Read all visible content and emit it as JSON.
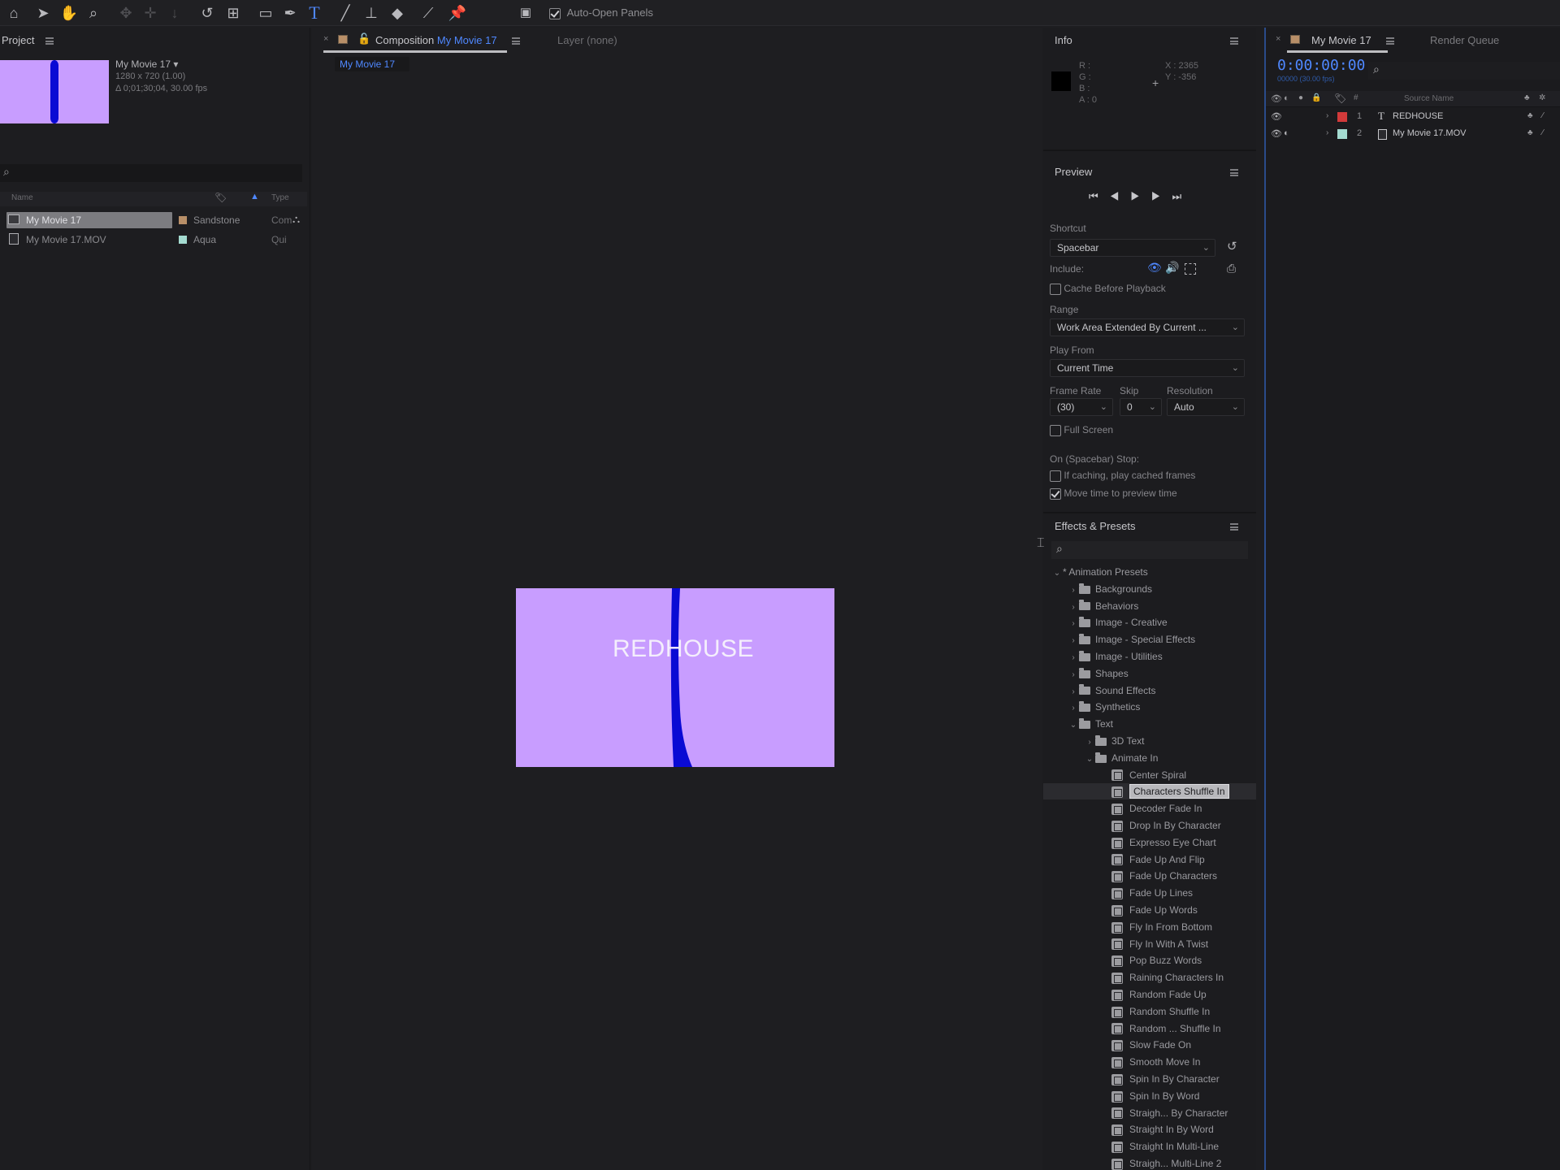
{
  "toolbar": {
    "tools": [
      "home-icon",
      "selection-tool-icon",
      "hand-tool-icon",
      "zoom-tool-icon",
      "orbit-camera-icon",
      "pan-camera-icon",
      "dolly-camera-icon",
      "rotate-tool-icon",
      "pan-behind-tool-icon",
      "rectangle-tool-icon",
      "pen-tool-icon",
      "type-tool-icon",
      "brush-tool-icon",
      "clone-stamp-tool-icon",
      "eraser-tool-icon",
      "roto-brush-tool-icon",
      "puppet-pin-tool-icon"
    ],
    "auto_open_label": "Auto-Open Panels",
    "auto_open_checked": true
  },
  "project": {
    "title": "Project",
    "comp_name": "My Movie 17",
    "comp_info_line1": "1280 x 720 (1.00)",
    "comp_info_line2": "Δ 0;01;30;04, 30.00 fps",
    "search_placeholder": "",
    "columns": {
      "name": "Name",
      "type": "Type"
    },
    "items": [
      {
        "name": "My Movie 17",
        "label": "Sandstone",
        "label_color": "#b88f68",
        "type": "Com",
        "selected": true
      },
      {
        "name": "My Movie 17.MOV",
        "label": "Aqua",
        "label_color": "#a4dbd0",
        "type": "Qui",
        "selected": false
      }
    ]
  },
  "composition": {
    "tab_prefix": "Composition",
    "tab_name": "My Movie 17",
    "layer_tab": "Layer (none)",
    "breadcrumb": "My Movie 17",
    "preview_text": "REDHOUSE",
    "frame_color": "#c89dff",
    "accent_color": "#0a0ad4"
  },
  "info": {
    "title": "Info",
    "r": "R :",
    "g": "G :",
    "b": "B :",
    "a": "A : 0",
    "x": "X : 2365",
    "y": "Y : -356"
  },
  "preview": {
    "title": "Preview",
    "shortcut_label": "Shortcut",
    "shortcut_value": "Spacebar",
    "include_label": "Include:",
    "cache_label": "Cache Before Playback",
    "range_label": "Range",
    "range_value": "Work Area Extended By Current ...",
    "play_from_label": "Play From",
    "play_from_value": "Current Time",
    "frame_rate_label": "Frame Rate",
    "skip_label": "Skip",
    "resolution_label": "Resolution",
    "frame_rate_value": "(30)",
    "skip_value": "0",
    "resolution_value": "Auto",
    "full_screen_label": "Full Screen",
    "stop_label": "On (Spacebar) Stop:",
    "if_caching_label": "If caching, play cached frames",
    "move_time_label": "Move time to preview time",
    "move_time_checked": true
  },
  "effects": {
    "title": "Effects & Presets",
    "root": "* Animation Presets",
    "folders": [
      "Backgrounds",
      "Behaviors",
      "Image - Creative",
      "Image - Special Effects",
      "Image - Utilities",
      "Shapes",
      "Sound Effects",
      "Synthetics",
      "Text"
    ],
    "text_subfolders": [
      "3D Text",
      "Animate In"
    ],
    "animate_in": [
      "Center Spiral",
      "Characters Shuffle In",
      "Decoder Fade In",
      "Drop In By Character",
      "Expresso Eye Chart",
      "Fade Up And Flip",
      "Fade Up Characters",
      "Fade Up Lines",
      "Fade Up Words",
      "Fly In From Bottom",
      "Fly In With A Twist",
      "Pop Buzz Words",
      "Raining Characters In",
      "Random Fade Up",
      "Random Shuffle In",
      "Random ... Shuffle In",
      "Slow Fade On",
      "Smooth Move In",
      "Spin In By Character",
      "Spin In By Word",
      "Straigh... By Character",
      "Straight In By Word",
      "Straight In Multi-Line",
      "Straigh... Multi-Line 2"
    ],
    "selected_preset": "Characters Shuffle In"
  },
  "timeline": {
    "tab_name": "My Movie 17",
    "render_queue": "Render Queue",
    "timecode": "0:00:00:00",
    "fps_sub": "00000 (30.00 fps)",
    "source_name_header": "Source Name",
    "layers": [
      {
        "num": "1",
        "name": "REDHOUSE",
        "color": "#d23a3a",
        "kind": "T"
      },
      {
        "num": "2",
        "name": "My Movie 17.MOV",
        "color": "#a4dbd0",
        "kind": "file"
      }
    ]
  }
}
